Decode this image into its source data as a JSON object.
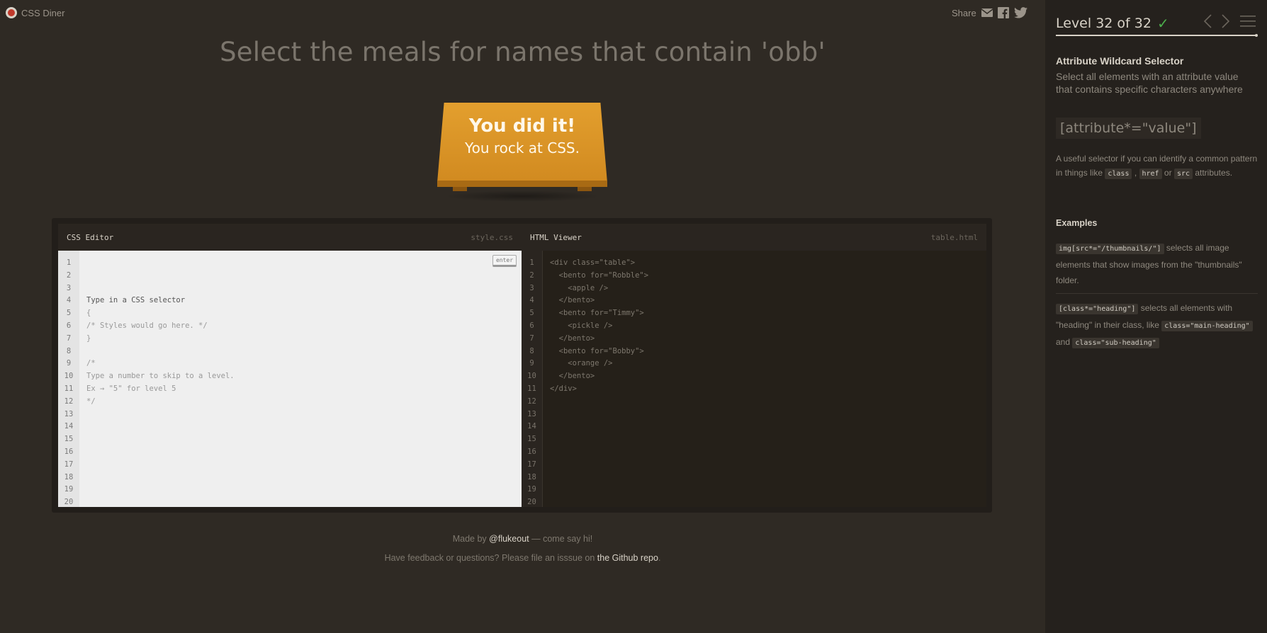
{
  "app": {
    "name": "CSS Diner"
  },
  "share": {
    "label": "Share",
    "icons": [
      "mail-icon",
      "facebook-icon",
      "twitter-icon"
    ]
  },
  "headline": "Select the meals for names that contain 'obb'",
  "win": {
    "line1": "You did it!",
    "line2": "You rock at CSS."
  },
  "css_editor": {
    "title": "CSS Editor",
    "file": "style.css",
    "enter_label": "enter",
    "lines": [
      "Type in a CSS selector",
      "{",
      "/* Styles would go here. */",
      "}",
      "",
      "/*",
      "Type a number to skip to a level.",
      "Ex → \"5\" for level 5",
      "*/",
      "",
      "",
      "",
      "",
      "",
      "",
      "",
      "",
      "",
      "",
      ""
    ],
    "line_numbers": [
      "1",
      "2",
      "3",
      "4",
      "5",
      "6",
      "7",
      "8",
      "9",
      "10",
      "11",
      "12",
      "13",
      "14",
      "15",
      "16",
      "17",
      "18",
      "19",
      "20"
    ]
  },
  "html_viewer": {
    "title": "HTML Viewer",
    "file": "table.html",
    "lines": [
      "<div class=\"table\">",
      "  <bento for=\"Robble\">",
      "    <apple />",
      "  </bento>",
      "  <bento for=\"Timmy\">",
      "    <pickle />",
      "  </bento>",
      "  <bento for=\"Bobby\">",
      "    <orange />",
      "  </bento>",
      "</div>",
      "",
      "",
      "",
      "",
      "",
      "",
      "",
      "",
      ""
    ],
    "line_numbers": [
      "1",
      "2",
      "3",
      "4",
      "5",
      "6",
      "7",
      "8",
      "9",
      "10",
      "11",
      "12",
      "13",
      "14",
      "15",
      "16",
      "17",
      "18",
      "19",
      "20"
    ]
  },
  "footer": {
    "made_by_prefix": "Made by ",
    "made_by_link": "@flukeout",
    "made_by_suffix": " — come say hi!",
    "feedback_prefix": "Have feedback or questions? Please file an isssue on ",
    "feedback_link": "the Github repo",
    "feedback_suffix": "."
  },
  "sidebar": {
    "level_text": "Level 32 of 32",
    "progress": 1.0,
    "selector_name": "Attribute Wildcard Selector",
    "selector_title": "Select all elements with an attribute value that contains specific characters anywhere",
    "syntax": "[attribute*=\"value\"]",
    "hint_1": "A useful selector if you can identify a common pattern in things like ",
    "hint_code_1": "class",
    "hint_sep": " , ",
    "hint_code_2": "href",
    "hint_or": " or ",
    "hint_code_3": "src",
    "hint_2": " attributes.",
    "examples_title": "Examples",
    "example_1_code": "img[src*=\"/thumbnails/\"]",
    "example_1_text": " selects all image elements that show images from the \"thumbnails\" folder.",
    "example_2_code": "[class*=\"heading\"]",
    "example_2_text_a": " selects all elements with \"heading\" in their class, like ",
    "example_2_code_b": "class=\"main-heading\"",
    "example_2_text_b": " and ",
    "example_2_code_c": "class=\"sub-heading\""
  },
  "colors": {
    "background": "#2f2a24",
    "sidebar": "#25211d",
    "table": "#e39f2e",
    "check": "#4cae4c"
  }
}
